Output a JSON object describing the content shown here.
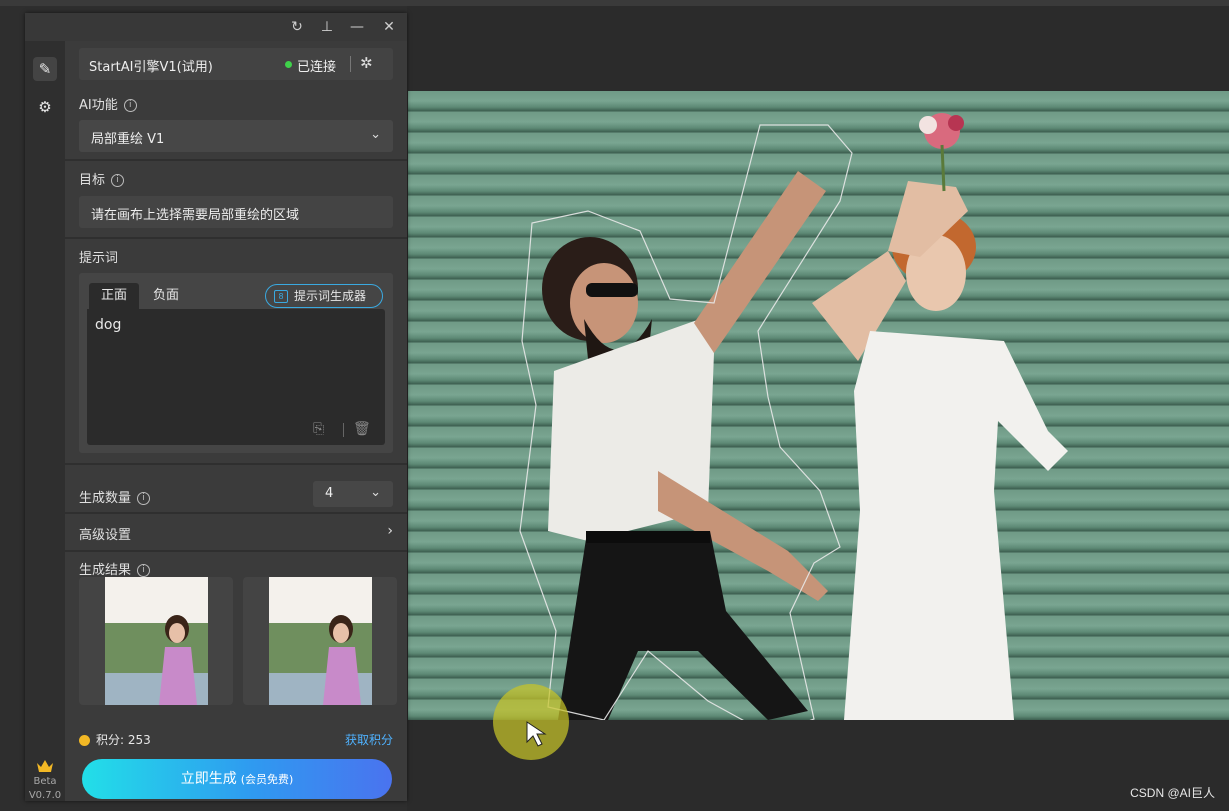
{
  "window": {
    "title_buttons": [
      "refresh-icon",
      "pin-icon",
      "minimize-icon",
      "close-icon"
    ]
  },
  "sidebar": {
    "icons": [
      "brush-icon",
      "gear-icon"
    ],
    "badge": "Beta",
    "version": "V0.7.0"
  },
  "engine": {
    "name": "StartAI引擎V1(试用)",
    "status": "已连接",
    "status_color": "#3fd14a"
  },
  "ai_function": {
    "label": "AI功能",
    "value": "局部重绘 V1"
  },
  "target": {
    "label": "目标",
    "value": "请在画布上选择需要局部重绘的区域"
  },
  "prompt": {
    "label": "提示词",
    "tabs": [
      "正面",
      "负面"
    ],
    "generator_label": "提示词生成器",
    "text": "dog"
  },
  "generate_count": {
    "label": "生成数量",
    "value": "4"
  },
  "advanced": {
    "label": "高级设置"
  },
  "results": {
    "label": "生成结果",
    "count": 2
  },
  "footer": {
    "points_label": "积分: 253",
    "get_points": "获取积分",
    "cta_label": "立即生成",
    "cta_sub": "(会员免费)"
  },
  "watermark": "CSDN @AI巨人",
  "colors": {
    "accent": "#3aa9e0",
    "cta_start": "#22dfe8",
    "cta_end": "#4a73ef",
    "link": "#4fb2ff"
  }
}
